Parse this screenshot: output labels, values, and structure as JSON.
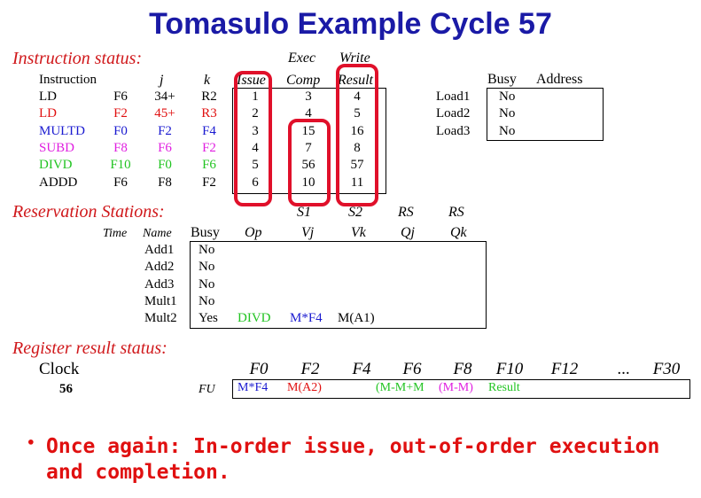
{
  "title": "Tomasulo Example Cycle 57",
  "instruction_status": {
    "label": "Instruction status:",
    "header_top": {
      "exec": "Exec",
      "write": "Write"
    },
    "headers": {
      "instruction": "Instruction",
      "j": "j",
      "k": "k",
      "issue": "Issue",
      "comp": "Comp",
      "result": "Result"
    },
    "rows": [
      {
        "op": "LD",
        "dest": "F6",
        "j": "34+",
        "k": "R2",
        "issue": "1",
        "comp": "3",
        "result": "4",
        "color": "#000000"
      },
      {
        "op": "LD",
        "dest": "F2",
        "j": "45+",
        "k": "R3",
        "issue": "2",
        "comp": "4",
        "result": "5",
        "color": "#e01010"
      },
      {
        "op": "MULTD",
        "dest": "F0",
        "j": "F2",
        "k": "F4",
        "issue": "3",
        "comp": "15",
        "result": "16",
        "color": "#1a1ad0"
      },
      {
        "op": "SUBD",
        "dest": "F8",
        "j": "F6",
        "k": "F2",
        "issue": "4",
        "comp": "7",
        "result": "8",
        "color": "#e020e0"
      },
      {
        "op": "DIVD",
        "dest": "F10",
        "j": "F0",
        "k": "F6",
        "issue": "5",
        "comp": "56",
        "result": "57",
        "color": "#22c422"
      },
      {
        "op": "ADDD",
        "dest": "F6",
        "j": "F8",
        "k": "F2",
        "issue": "6",
        "comp": "10",
        "result": "11",
        "color": "#000000"
      }
    ]
  },
  "load_buffers": {
    "headers": {
      "busy": "Busy",
      "address": "Address"
    },
    "rows": [
      {
        "name": "Load1",
        "busy": "No",
        "address": ""
      },
      {
        "name": "Load2",
        "busy": "No",
        "address": ""
      },
      {
        "name": "Load3",
        "busy": "No",
        "address": ""
      }
    ]
  },
  "reservation_stations": {
    "label": "Reservation Stations:",
    "header_top": {
      "s1": "S1",
      "s2": "S2",
      "rs1": "RS",
      "rs2": "RS"
    },
    "headers": {
      "time": "Time",
      "name": "Name",
      "busy": "Busy",
      "op": "Op",
      "vj": "Vj",
      "vk": "Vk",
      "qj": "Qj",
      "qk": "Qk"
    },
    "rows": [
      {
        "name": "Add1",
        "busy": "No",
        "op": "",
        "vj": "",
        "vk": ""
      },
      {
        "name": "Add2",
        "busy": "No",
        "op": "",
        "vj": "",
        "vk": ""
      },
      {
        "name": "Add3",
        "busy": "No",
        "op": "",
        "vj": "",
        "vk": ""
      },
      {
        "name": "Mult1",
        "busy": "No",
        "op": "",
        "vj": "",
        "vk": ""
      },
      {
        "name": "Mult2",
        "busy": "Yes",
        "op": "DIVD",
        "vj": "M*F4",
        "vk": "M(A1)"
      }
    ]
  },
  "register_status": {
    "label": "Register result status:",
    "clock_label": "Clock",
    "clock_value": "56",
    "fu_label": "FU",
    "registers": [
      "F0",
      "F2",
      "F4",
      "F6",
      "F8",
      "F10",
      "F12",
      "...",
      "F30"
    ],
    "values": [
      {
        "text": "M*F4",
        "color": "#1a1ad0"
      },
      {
        "text": "M(A2)",
        "color": "#e01010"
      },
      {
        "text": "",
        "color": "#000000"
      },
      {
        "text": "(M-M+M",
        "color": "#22c422"
      },
      {
        "text": "(M-M)",
        "color": "#e020e0"
      },
      {
        "text": "Result",
        "color": "#22c422"
      }
    ]
  },
  "bullet": {
    "marker": "•",
    "line1": "Once again: In-order issue, out-of-order execution",
    "line2": "and completion."
  }
}
